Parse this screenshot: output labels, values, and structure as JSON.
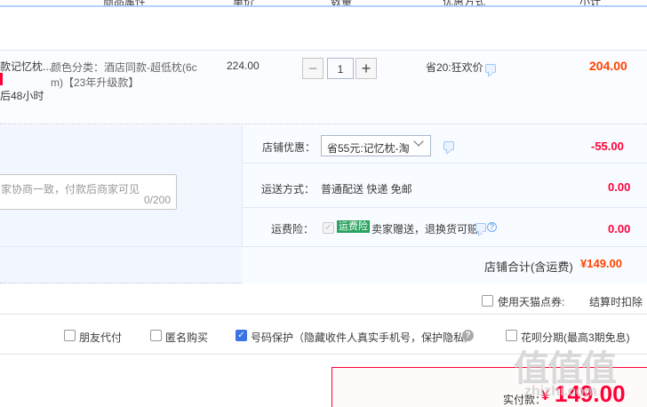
{
  "header": {
    "col_attrs": "商品属性",
    "col_unit_price": "单价",
    "col_qty": "数量",
    "col_discount": "优惠方式",
    "col_subtotal": "小计"
  },
  "item": {
    "title_partial": "款记忆枕...",
    "ship_note": "后48小时",
    "attrs_line1": "颜色分类：酒店同款-超低枕(6c",
    "attrs_line2": "m)【23年升级款】",
    "unit_price": "224.00",
    "qty": "1",
    "qty_minus": "−",
    "qty_plus": "+",
    "discount": "省20:狂欢价",
    "subtotal": "204.00"
  },
  "shop": {
    "coupon_label": "店铺优惠：",
    "coupon_select": "省55元:记忆枕-淘",
    "coupon_amount": "-55.00",
    "shipping_label": "运送方式：",
    "shipping_value": "普通配送 快递 免邮",
    "shipping_amount": "0.00",
    "insurance_label": "运费险：",
    "insurance_tag": "运费险",
    "insurance_text": "卖家赠送，退换货可赔",
    "insurance_amount": "0.00",
    "memo_placeholder": "家协商一致，付款后商家可见",
    "memo_count": "0/200",
    "total_label": "店铺合计(含运费)",
    "total_amount": "¥149.00"
  },
  "options": {
    "tmall_coupon": "使用天猫点券:",
    "settle_note": "结算时扣除",
    "friend_pay": "朋友代付",
    "anonymous": "匿名购买",
    "number_protect": "号码保护（隐藏收件人真实手机号，保护隐私）",
    "huabei": "花呗分期(最高3期免息)"
  },
  "payment": {
    "label": "实付款：",
    "currency": "¥",
    "amount": "149.00"
  },
  "watermark": {
    "logo": "值",
    "url": "zhizhi.com"
  }
}
